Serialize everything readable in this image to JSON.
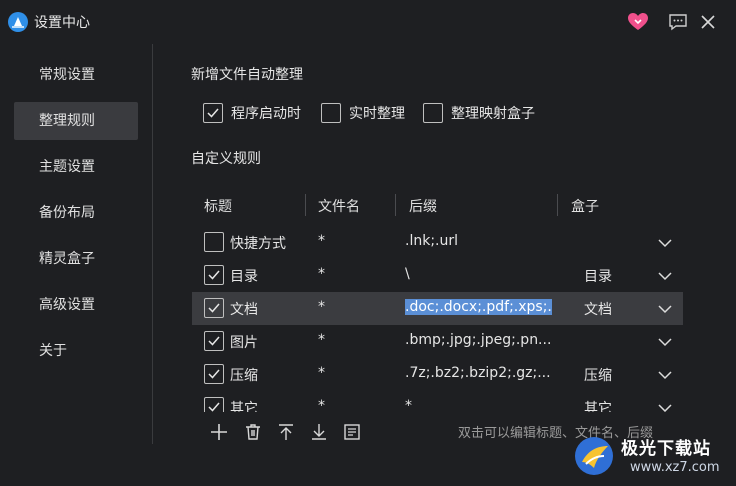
{
  "window": {
    "title": "设置中心",
    "icons": [
      "app-logo-icon",
      "heart-icon",
      "feedback-icon",
      "close-icon"
    ]
  },
  "sidebar": {
    "items": [
      {
        "label": "常规设置",
        "active": false
      },
      {
        "label": "整理规则",
        "active": true
      },
      {
        "label": "主题设置",
        "active": false
      },
      {
        "label": "备份布局",
        "active": false
      },
      {
        "label": "精灵盒子",
        "active": false
      },
      {
        "label": "高级设置",
        "active": false
      },
      {
        "label": "关于",
        "active": false
      }
    ]
  },
  "auto_organize": {
    "title": "新增文件自动整理",
    "options": [
      {
        "label": "程序启动时",
        "checked": true
      },
      {
        "label": "实时整理",
        "checked": false
      },
      {
        "label": "整理映射盒子",
        "checked": false
      }
    ]
  },
  "custom_rules": {
    "title": "自定义规则",
    "columns": [
      "标题",
      "文件名",
      "后缀",
      "盒子"
    ],
    "rows": [
      {
        "checked": false,
        "title": "快捷方式",
        "name": "*",
        "suffix": ".lnk;.url",
        "box": ""
      },
      {
        "checked": true,
        "title": "目录",
        "name": "*",
        "suffix": "\\",
        "box": "目录"
      },
      {
        "checked": true,
        "title": "文档",
        "name": "*",
        "suffix": ".doc;.docx;.pdf;.xps;.",
        "box": "文档",
        "selected": true
      },
      {
        "checked": true,
        "title": "图片",
        "name": "*",
        "suffix": ".bmp;.jpg;.jpeg;.pn...",
        "box": ""
      },
      {
        "checked": true,
        "title": "压缩",
        "name": "*",
        "suffix": ".7z;.bz2;.bzip2;.gz;...",
        "box": "压缩"
      },
      {
        "checked": true,
        "title": "其它",
        "name": "*",
        "suffix": "*",
        "box": "其它"
      }
    ]
  },
  "toolbar": {
    "icons": [
      "add-icon",
      "delete-icon",
      "move-top-icon",
      "move-bottom-icon",
      "list-icon"
    ],
    "hint": "双击可以编辑标题、文件名、后缀"
  },
  "watermark": {
    "line1": "极光下载站",
    "line2": "www.xz7.com"
  },
  "colors": {
    "background": "#1e1f22",
    "active_item": "#3a3b3f",
    "selection": "#5b8fd6",
    "heart": "#f0508c",
    "logo": "#2f8fe8"
  }
}
